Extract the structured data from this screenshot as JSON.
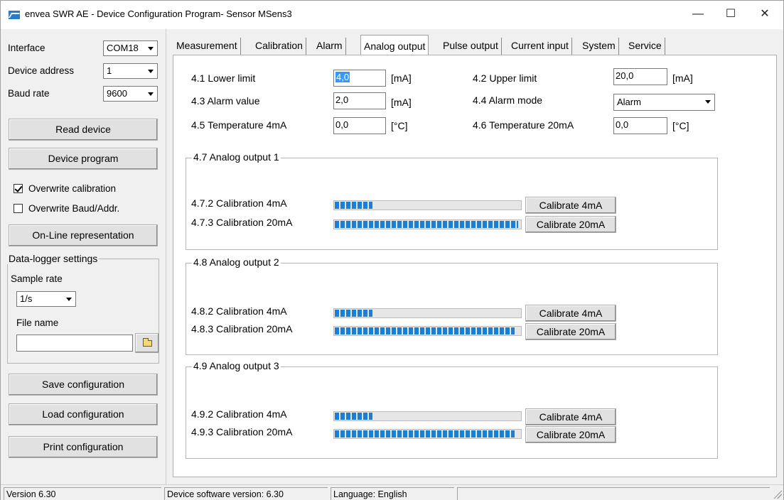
{
  "window": {
    "title": "envea SWR AE - Device Configuration Program- Sensor MSens3",
    "min_glyph": "—",
    "max_glyph": "☐",
    "close_glyph": "✕"
  },
  "left": {
    "interface_label": "Interface",
    "interface_value": "COM18",
    "device_address_label": "Device address",
    "device_address_value": "1",
    "baud_rate_label": "Baud rate",
    "baud_rate_value": "9600",
    "read_device": "Read device",
    "device_program": "Device program",
    "overwrite_calibration": "Overwrite calibration",
    "overwrite_calibration_checked": true,
    "overwrite_baud": "Overwrite Baud/Addr.",
    "overwrite_baud_checked": false,
    "online": "On-Line representation",
    "datalogger_title": "Data-logger settings",
    "sample_rate_label": "Sample rate",
    "sample_rate_value": "1/s",
    "file_name_label": "File name",
    "file_name_value": "",
    "save_config": "Save configuration",
    "load_config": "Load configuration",
    "print_config": "Print configuration"
  },
  "tabs": [
    "Measurement",
    "Calibration",
    "Alarm",
    "Analog output",
    "Pulse output",
    "Current input",
    "System",
    "Service"
  ],
  "analog": {
    "lower_limit_label": "4.1 Lower limit",
    "lower_limit_value": "4,0",
    "upper_limit_label": "4.2 Upper limit",
    "upper_limit_value": "20,0",
    "alarm_value_label": "4.3 Alarm value",
    "alarm_value_value": "2,0",
    "alarm_mode_label": "4.4 Alarm mode",
    "alarm_mode_value": "Alarm",
    "temp4_label": "4.5 Temperature 4mA",
    "temp4_value": "0,0",
    "temp20_label": "4.6 Temperature 20mA",
    "temp20_value": "0,0",
    "unit_ma": "[mA]",
    "unit_c": "[°C]"
  },
  "outputs": [
    {
      "title": "4.7 Analog output 1",
      "cal4_label": "4.7.2 Calibration 4mA",
      "cal20_label": "4.7.3 Calibration 20mA",
      "cal4_progress": 0.21,
      "cal20_progress": 0.99,
      "cal4_button": "Calibrate 4mA",
      "cal20_button": "Calibrate 20mA"
    },
    {
      "title": "4.8 Analog output 2",
      "cal4_label": "4.8.2 Calibration 4mA",
      "cal20_label": "4.8.3 Calibration 20mA",
      "cal4_progress": 0.21,
      "cal20_progress": 0.97,
      "cal4_button": "Calibrate 4mA",
      "cal20_button": "Calibrate 20mA"
    },
    {
      "title": "4.9 Analog output 3",
      "cal4_label": "4.9.2 Calibration 4mA",
      "cal20_label": "4.9.3 Calibration 20mA",
      "cal4_progress": 0.21,
      "cal20_progress": 0.97,
      "cal4_button": "Calibrate 4mA",
      "cal20_button": "Calibrate 20mA"
    }
  ],
  "status": {
    "version": "Version 6.30",
    "device_sw": "Device software version: 6.30",
    "language": "Language: English"
  }
}
